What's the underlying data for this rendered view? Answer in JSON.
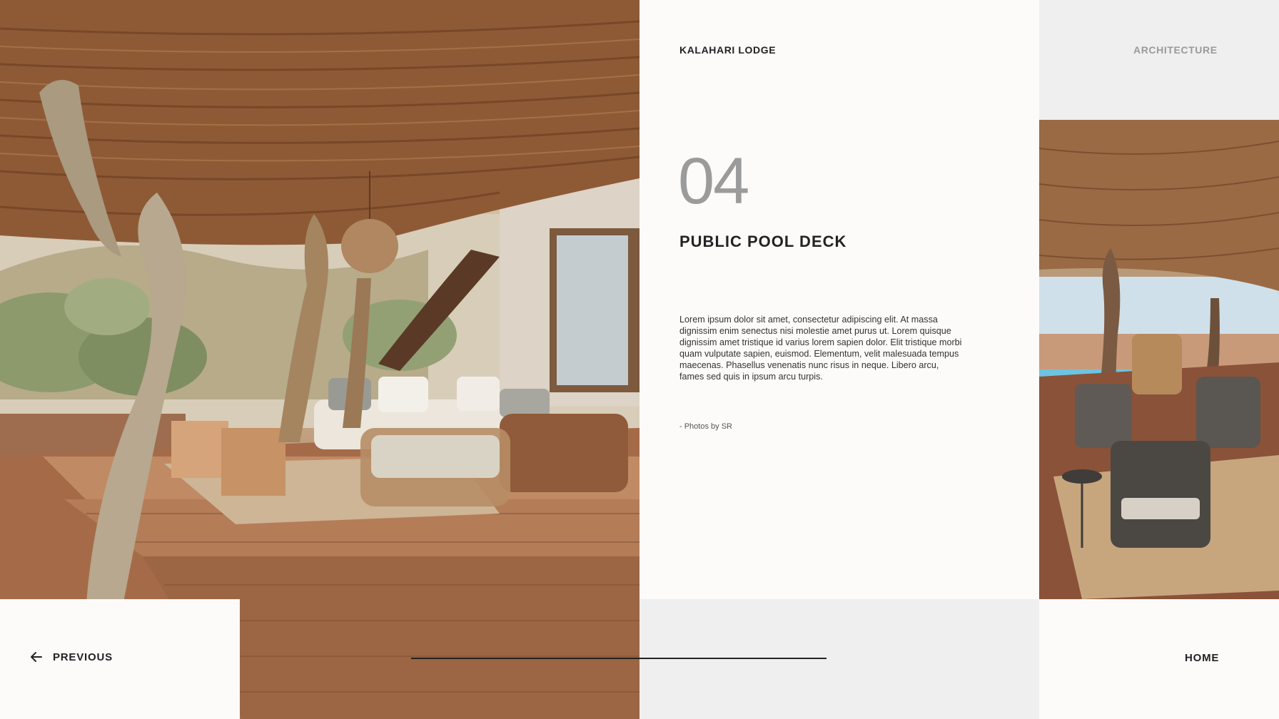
{
  "header": {
    "brand": "KALAHARI LODGE",
    "category": "ARCHITECTURE"
  },
  "content": {
    "number": "04",
    "title": "PUBLIC POOL DECK",
    "body": "Lorem ipsum dolor sit amet, consectetur adipiscing elit. At massa dignissim enim senectus nisi molestie amet purus ut. Lorem quisque dignissim amet tristique id varius lorem sapien dolor. Elit tristique morbi quam vulputate sapien, euismod. Elementum, velit malesuada tempus maecenas. Phasellus venenatis nunc risus in neque. Libero arcu, fames sed quis in ipsum arcu turpis.",
    "credit": "- Photos by SR"
  },
  "nav": {
    "previous_label": "PREVIOUS",
    "home_label": "HOME",
    "previous_icon": "arrow-left-icon"
  },
  "colors": {
    "accent_text": "#222222",
    "muted_text": "#9b9b9b",
    "panel_light": "#efefef",
    "panel_white": "#fdfafa"
  }
}
